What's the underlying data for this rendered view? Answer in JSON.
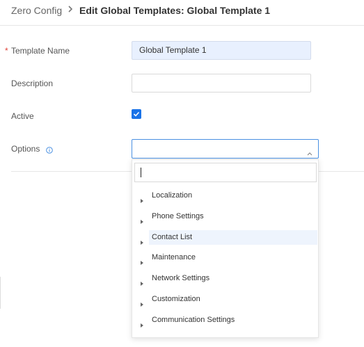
{
  "breadcrumb": {
    "root": "Zero Config",
    "separator_icon": "chevron-right-icon",
    "title": "Edit Global Templates: Global Template 1"
  },
  "form": {
    "template_name": {
      "label": "Template Name",
      "required_mark": "*",
      "value": "Global Template 1"
    },
    "description": {
      "label": "Description",
      "value": ""
    },
    "active": {
      "label": "Active",
      "checked": true
    },
    "options": {
      "label": "Options",
      "info_icon": "info-icon",
      "value": ""
    }
  },
  "dropdown": {
    "search_value": "",
    "items": [
      {
        "label": "Localization"
      },
      {
        "label": "Phone Settings"
      },
      {
        "label": "Contact List",
        "highlighted": true
      },
      {
        "label": "Maintenance"
      },
      {
        "label": "Network Settings"
      },
      {
        "label": "Customization"
      },
      {
        "label": "Communication Settings"
      }
    ]
  },
  "colors": {
    "accent": "#1a73e8",
    "required": "#e0443a",
    "filled_input": "#e8f0fe",
    "highlight_row": "#eef4fd"
  }
}
